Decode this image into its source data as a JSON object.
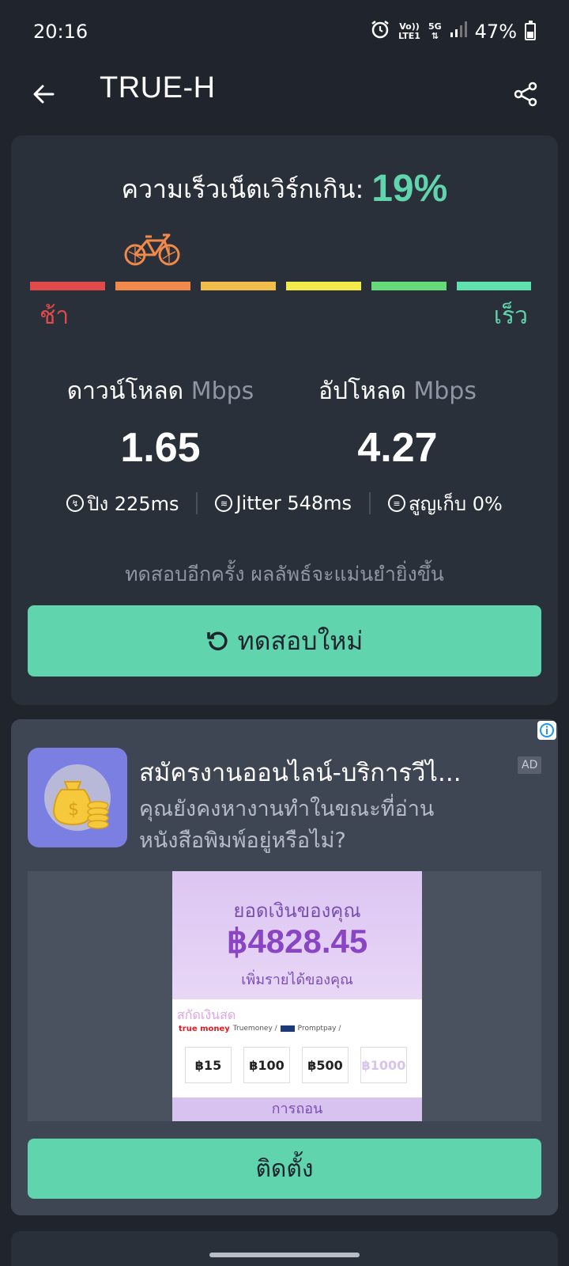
{
  "status_bar": {
    "time": "20:16",
    "volte": "Vo))",
    "lte": "LTE1",
    "network": "5G",
    "battery": "47%",
    "icons": [
      "alarm-icon",
      "signal-icon",
      "battery-icon"
    ]
  },
  "app_bar": {
    "title": "TRUE-H",
    "back_icon": "arrow-left-icon",
    "share_icon": "share-icon"
  },
  "result": {
    "headline_prefix": "ความเร็วเน็ตเวิร์กเกิน:",
    "percent": "19%",
    "meter_colors": [
      "#e14a4a",
      "#f0894a",
      "#f2bd4a",
      "#f2e94a",
      "#66d978",
      "#5fe0ad"
    ],
    "meter_level": 2,
    "slow_label": "ช้า",
    "fast_label": "เร็ว",
    "download": {
      "label": "ดาวน์โหลด",
      "unit": "Mbps",
      "value": "1.65"
    },
    "upload": {
      "label": "อัปโหลด",
      "unit": "Mbps",
      "value": "4.27"
    },
    "ping": "ปิง 225ms",
    "jitter": "Jitter 548ms",
    "loss": "สูญเก็บ 0%",
    "hint": "ทดสอบอีกครั้ง ผลลัพธ์จะแม่นยำยิ่งขึ้น",
    "retest_label": "ทดสอบใหม่"
  },
  "ad": {
    "title": "สมัครงานออนไลน์-บริการวีไ...",
    "badge": "AD",
    "description": "คุณยังคงหางานทำในขณะที่อ่านหนังสือพิมพ์อยู่หรือไม่?",
    "creative": {
      "title": "ยอดเงินของคุณ",
      "amount": "฿4828.45",
      "subtitle": "เพิ่มรายได้ของคุณ",
      "panel_title": "สกัดเงินสด",
      "truemoney_logo": "true money",
      "truemoney": "Truemoney /",
      "promptpay": "Promptpay /",
      "options": [
        "฿15",
        "฿100",
        "฿500",
        "฿1000"
      ],
      "footer": "การถอน"
    },
    "install_label": "ติดตั้ง"
  }
}
